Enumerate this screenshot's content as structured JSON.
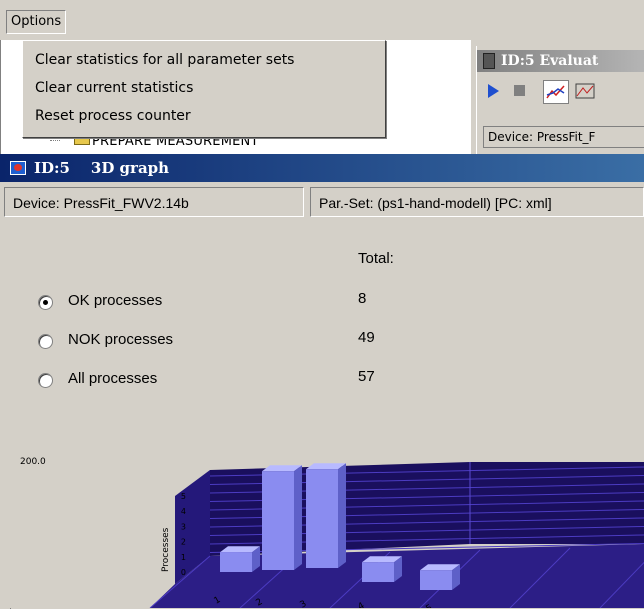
{
  "menubar": {
    "options_label": "Options"
  },
  "options_menu": {
    "items": [
      "Clear statistics for all parameter sets",
      "Clear current statistics",
      "Reset process counter"
    ]
  },
  "tree": {
    "item_label": "PREPARE MEASUREMENT"
  },
  "eval_window": {
    "title": "ID:5  Evaluat",
    "device": "Device: PressFit_F"
  },
  "main_window": {
    "title": "ID:5    3D graph",
    "device": "Device: PressFit_FWV2.14b",
    "parset": "Par.-Set:  (ps1-hand-modell) [PC: xml]",
    "total_header": "Total:",
    "options": [
      {
        "label": "OK processes",
        "total": "8",
        "selected": true
      },
      {
        "label": "NOK processes",
        "total": "49",
        "selected": false
      },
      {
        "label": "All processes",
        "total": "57",
        "selected": false
      }
    ]
  },
  "colors": {
    "title_active": "#0a246a",
    "chart_bg": "#1a0f5e",
    "bar": "#8a8cf0"
  },
  "chart_data": {
    "type": "bar",
    "categories": [
      "1",
      "2",
      "3",
      "4",
      "5"
    ],
    "values": [
      1,
      5,
      5,
      1,
      1
    ],
    "ylabel": "Processes",
    "ytick_labels": [
      "0",
      "1",
      "2",
      "3",
      "4",
      "5"
    ],
    "corner_label": "200.0",
    "ylim": [
      0,
      5
    ]
  }
}
